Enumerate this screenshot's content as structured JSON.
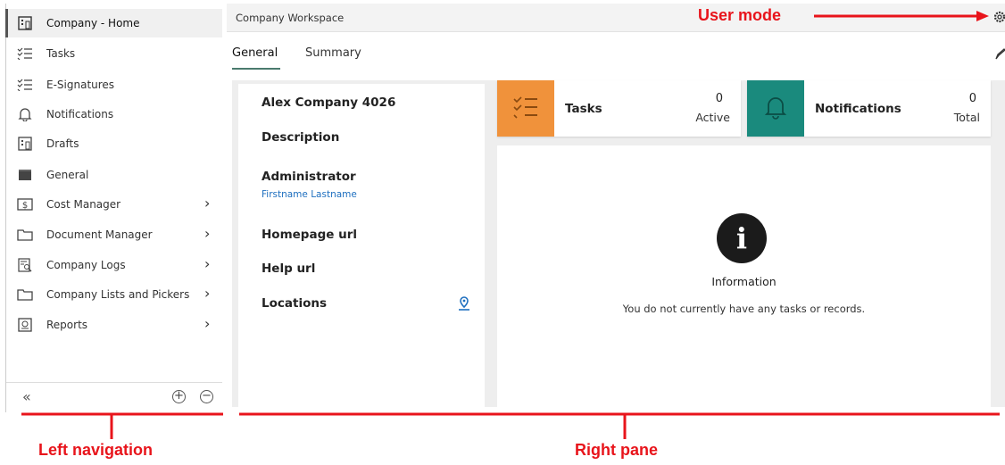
{
  "left_nav": {
    "items": [
      {
        "label": "Company - Home",
        "icon": "building-icon",
        "active": true,
        "has_children": false
      },
      {
        "label": "Tasks",
        "icon": "checklist-icon",
        "active": false,
        "has_children": false
      },
      {
        "label": "E-Signatures",
        "icon": "checklist-icon",
        "active": false,
        "has_children": false
      },
      {
        "label": "Notifications",
        "icon": "bell-icon",
        "active": false,
        "has_children": false
      },
      {
        "label": "Drafts",
        "icon": "building-icon",
        "active": false,
        "has_children": false
      },
      {
        "label": "General",
        "icon": "folder-filled-icon",
        "active": false,
        "has_children": false
      },
      {
        "label": "Cost Manager",
        "icon": "dollar-icon",
        "active": false,
        "has_children": true
      },
      {
        "label": "Document Manager",
        "icon": "folder-icon",
        "active": false,
        "has_children": true
      },
      {
        "label": "Company Logs",
        "icon": "log-search-icon",
        "active": false,
        "has_children": true
      },
      {
        "label": "Company Lists and Pickers",
        "icon": "folder-icon",
        "active": false,
        "has_children": true
      },
      {
        "label": "Reports",
        "icon": "report-icon",
        "active": false,
        "has_children": true
      }
    ],
    "footer": {
      "collapse": "«",
      "expand_all": "+",
      "collapse_all": "−"
    }
  },
  "right_pane": {
    "workspace_title": "Company Workspace",
    "tabs": [
      {
        "label": "General",
        "selected": true
      },
      {
        "label": "Summary",
        "selected": false
      }
    ],
    "company": {
      "name": "Alex Company 4026",
      "description_label": "Description",
      "administrator_label": "Administrator",
      "administrator_value": "Firstname Lastname",
      "homepage_label": "Homepage url",
      "help_label": "Help url",
      "locations_label": "Locations"
    },
    "tasks_card": {
      "label": "Tasks",
      "value": "0",
      "sub": "Active",
      "color": "#f0923b"
    },
    "notifications_card": {
      "label": "Notifications",
      "value": "0",
      "sub": "Total",
      "color": "#1a8a7d"
    },
    "info_panel": {
      "icon_glyph": "i",
      "title": "Information",
      "message": "You do not currently have any tasks or records."
    }
  },
  "annotations": {
    "user_mode": "User mode",
    "left_nav": "Left navigation",
    "right_pane": "Right pane",
    "color": "#e8141b"
  }
}
